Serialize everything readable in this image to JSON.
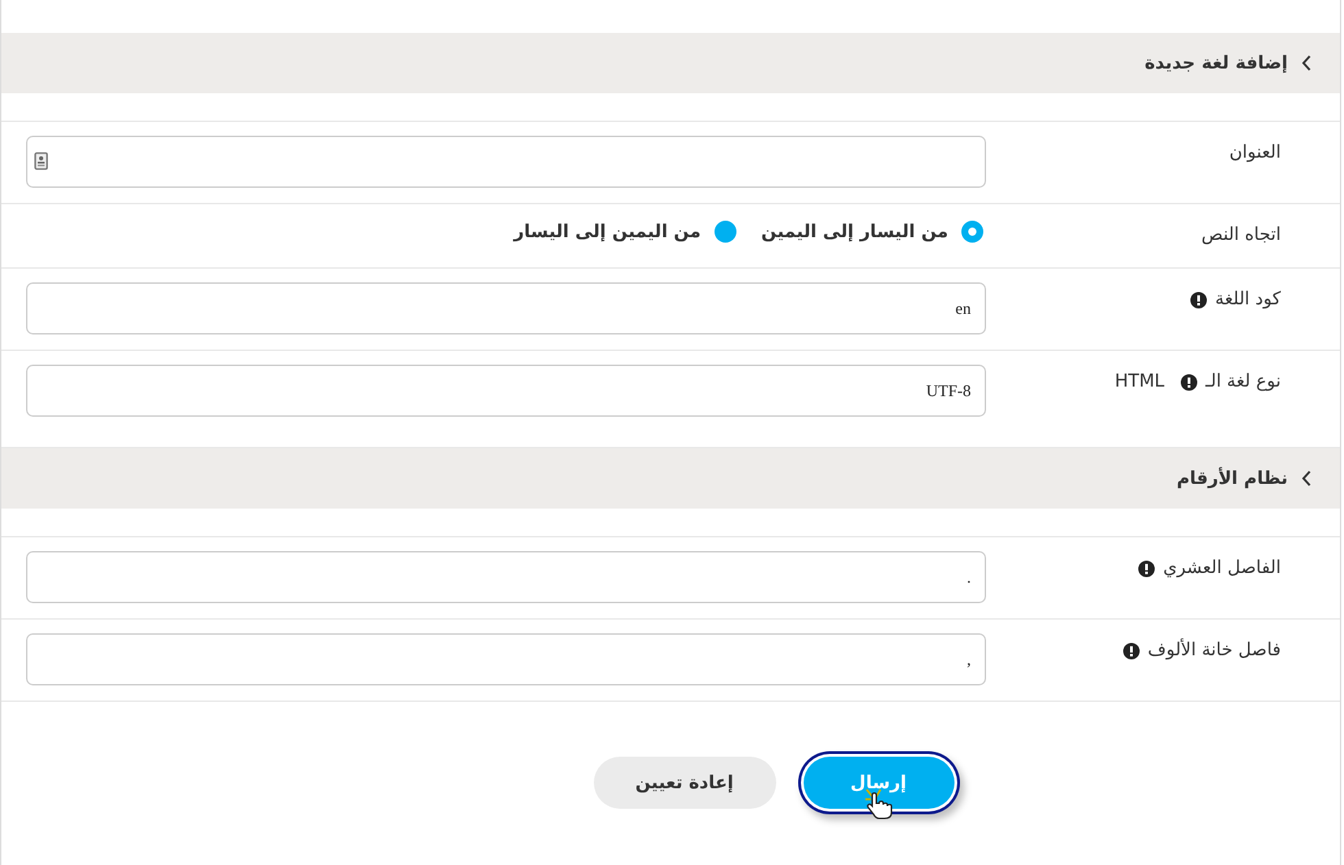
{
  "sections": [
    {
      "title": "إضافة لغة جديدة",
      "expanded": true,
      "fields": [
        {
          "kind": "text",
          "label": "العنوان",
          "autofill_icon": true
        },
        {
          "kind": "radio",
          "label": "اتجاه النص",
          "options": [
            {
              "label": "من اليسار إلى اليمين",
              "selected": true
            },
            {
              "label": "من اليمين إلى اليسار",
              "selected": false
            }
          ]
        },
        {
          "kind": "text",
          "label": "كود اللغة",
          "info": true,
          "value": "en"
        },
        {
          "kind": "text",
          "label": "نوع لغة الـ",
          "label_suffix": "HTML",
          "info": true,
          "value": "UTF-8"
        }
      ]
    },
    {
      "title": "نظام الأرقام",
      "expanded": true,
      "fields": [
        {
          "kind": "text",
          "label": "الفاصل العشري",
          "info": true,
          "value": "."
        },
        {
          "kind": "text",
          "label": "فاصل خانة الألوف",
          "info": true,
          "value": ","
        }
      ]
    }
  ],
  "buttons": [
    {
      "kind": "primary",
      "label": "إرسال",
      "focused": true
    },
    {
      "kind": "secondary",
      "label": "إعادة تعيين",
      "focused": false
    }
  ]
}
